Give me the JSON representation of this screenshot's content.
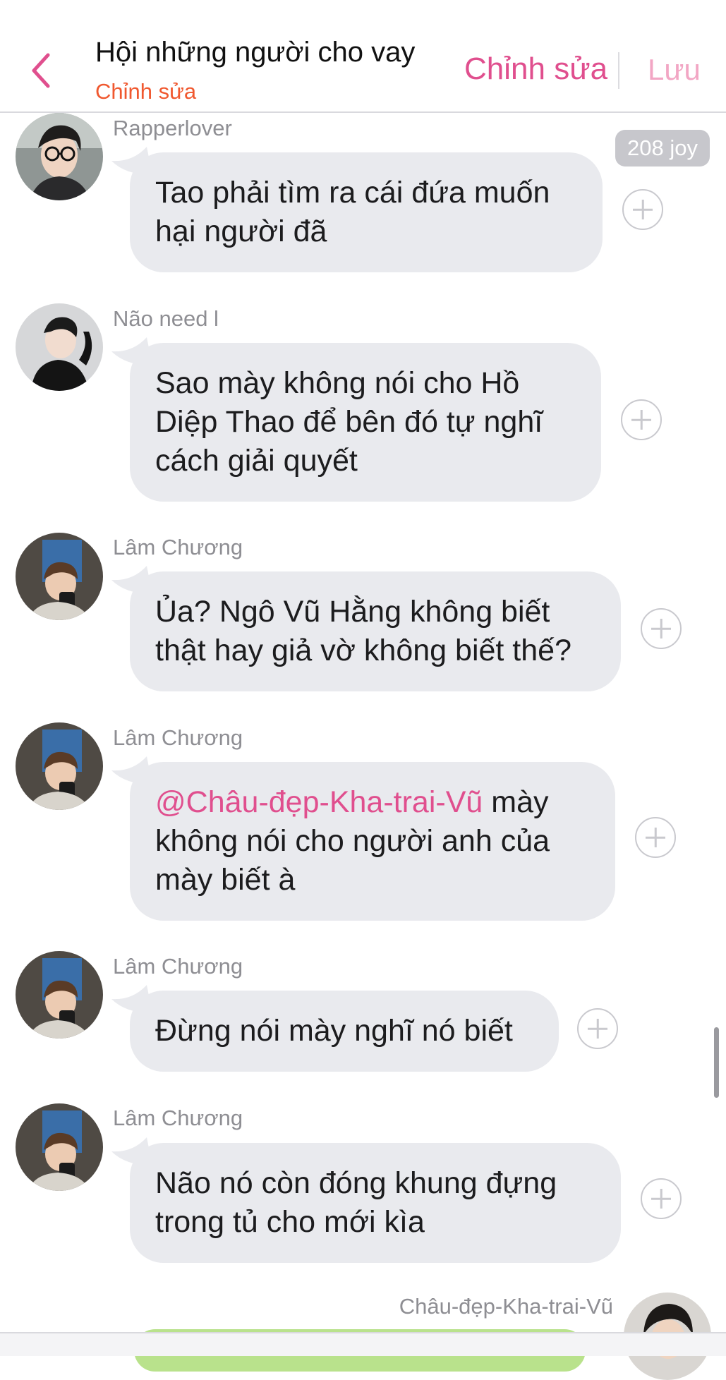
{
  "header": {
    "title": "Hội những người cho vay",
    "subtitle": "Chỉnh sửa",
    "edit_label": "Chỉnh sửa",
    "save_label": "Lưu",
    "back_icon": "chevron-left-icon",
    "accent_color": "#e04f8e",
    "subtitle_color": "#f0582f"
  },
  "badge": {
    "joy": "208 joy"
  },
  "messages": [
    {
      "sender": "Rapperlover",
      "lines": [
        "Tao phải tìm ra cái đứa muốn",
        "hại người đã"
      ]
    },
    {
      "sender": "Não need l",
      "lines": [
        "Sao mày không nói cho Hồ",
        "Diệp Thao để bên đó tự nghĩ",
        "cách giải quyết"
      ]
    },
    {
      "sender": "Lâm Chương",
      "lines": [
        "Ủa? Ngô Vũ Hằng không biết",
        "thật hay giả vờ không biết thế?"
      ]
    },
    {
      "sender": "Lâm Chương",
      "mention": "@Châu-đẹp-Kha-trai-Vũ",
      "lines": [
        " mày",
        "không nói cho người anh của",
        "mày biết à"
      ]
    },
    {
      "sender": "Lâm Chương",
      "lines": [
        "Đừng nói mày nghĩ nó biết"
      ]
    },
    {
      "sender": "Lâm Chương",
      "lines": [
        "Não nó còn đóng khung đựng",
        "trong tủ cho mới kìa"
      ]
    }
  ],
  "outgoing": {
    "sender": "Châu-đẹp-Kha-trai-Vũ"
  }
}
